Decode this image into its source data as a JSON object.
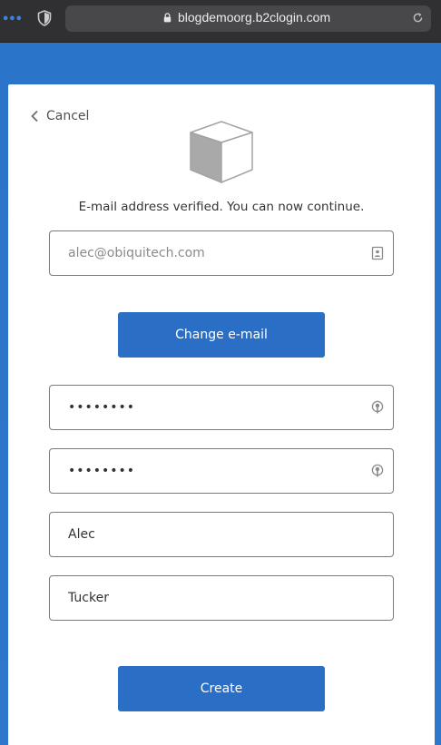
{
  "browser": {
    "url": "blogdemoorg.b2clogin.com",
    "menu_glyph": "•••"
  },
  "page": {
    "cancel_label": "Cancel",
    "status_message": "E-mail address verified. You can now continue.",
    "email": {
      "value": "alec@obiquitech.com"
    },
    "change_email_label": "Change e-mail",
    "password": {
      "value": "••••••••"
    },
    "confirm_password": {
      "value": "••••••••"
    },
    "given_name": {
      "value": "Alec"
    },
    "surname": {
      "value": "Tucker"
    },
    "create_label": "Create"
  },
  "colors": {
    "background": "#2a73c8",
    "button": "#2a6fc5",
    "card": "#ffffff",
    "field_border": "#7a7a7a"
  }
}
